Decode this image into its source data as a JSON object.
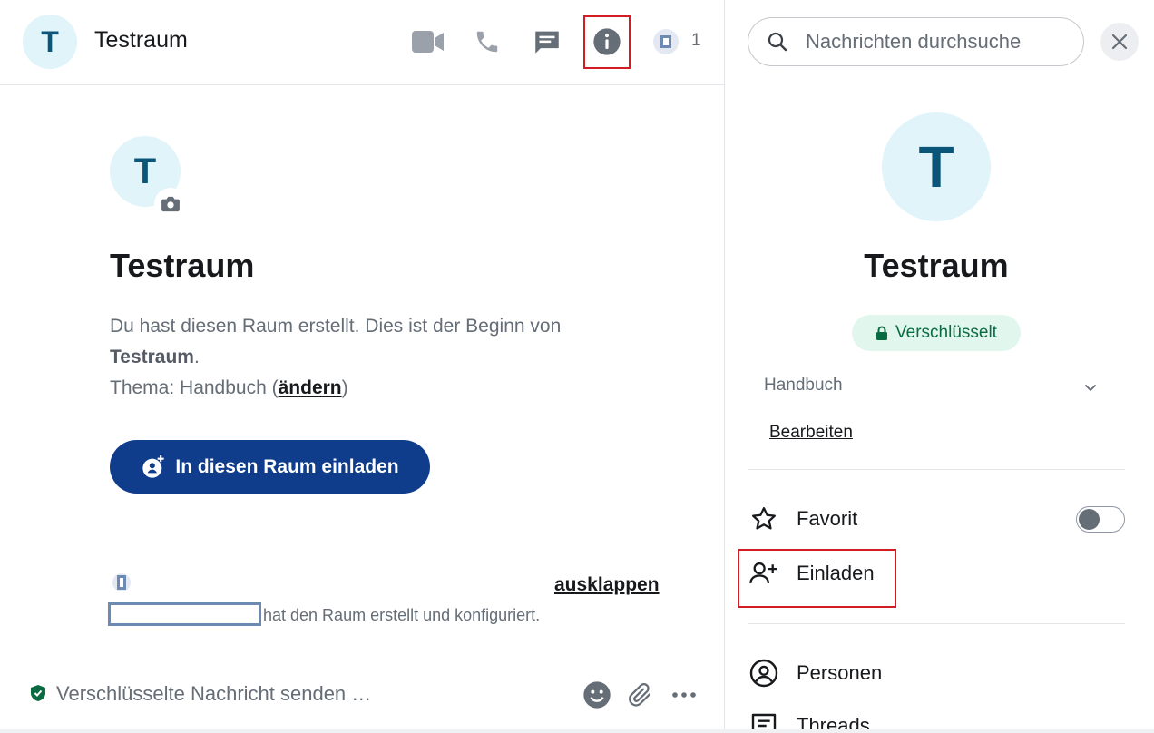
{
  "room": {
    "initial": "T",
    "name": "Testraum"
  },
  "header": {
    "member_count": "1",
    "icons": [
      "video-call-icon",
      "voice-call-icon",
      "threads-icon",
      "room-info-icon"
    ]
  },
  "timeline": {
    "heading": "Testraum",
    "intro_before": "Du hast diesen Raum erstellt. Dies ist der Beginn von ",
    "intro_room": "Testraum",
    "intro_after": ".",
    "topic_prefix": "Thema: Handbuch (",
    "topic_change_link": "ändern",
    "topic_suffix": ")",
    "invite_button": "In diesen Raum einladen",
    "expand_link": "ausklappen",
    "created_text": "hat den Raum erstellt und konfiguriert."
  },
  "composer": {
    "placeholder": "Verschlüsselte Nachricht senden …"
  },
  "right_panel": {
    "search_placeholder": "Nachrichten durchsuche",
    "title": "Testraum",
    "encrypted_label": "Verschlüsselt",
    "topic": "Handbuch",
    "edit_link": "Bearbeiten",
    "favorite_label": "Favorit",
    "favorite_enabled": false,
    "invite_label": "Einladen",
    "people_label": "Personen",
    "threads_label": "Threads"
  },
  "colors": {
    "accent": "#0f3d8b",
    "avatar_bg": "#e0f4f9",
    "avatar_text": "#0b5579",
    "encrypted_bg": "#e1f7ed",
    "encrypted_text": "#0a6b42",
    "highlight": "#d41c25"
  }
}
